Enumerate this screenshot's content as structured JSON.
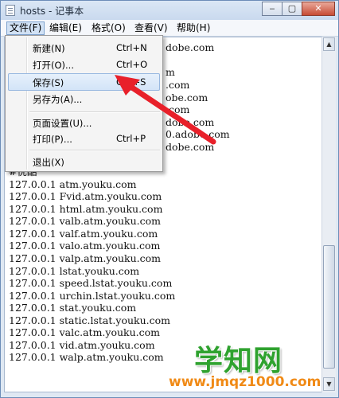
{
  "window": {
    "title": "hosts - 记事本"
  },
  "menubar": {
    "items": [
      {
        "label": "文件(F)"
      },
      {
        "label": "编辑(E)"
      },
      {
        "label": "格式(O)"
      },
      {
        "label": "查看(V)"
      },
      {
        "label": "帮助(H)"
      }
    ]
  },
  "file_menu": {
    "items": [
      {
        "label": "新建(N)",
        "shortcut": "Ctrl+N"
      },
      {
        "label": "打开(O)...",
        "shortcut": "Ctrl+O"
      },
      {
        "label": "保存(S)",
        "shortcut": "Ctrl+S"
      },
      {
        "label": "另存为(A)..."
      },
      {
        "label": "页面设置(U)..."
      },
      {
        "label": "打印(P)...",
        "shortcut": "Ctrl+P"
      },
      {
        "label": "退出(X)"
      }
    ]
  },
  "editor": {
    "hidden_fragments": [
      "dobe.com",
      "m",
      ".com",
      "obe.com",
      ".com",
      "dobe.com",
      "0.adobe.com",
      "dobe.com",
      "#优酷"
    ],
    "lines": [
      "127.0.0.1 atm.youku.com",
      "127.0.0.1 Fvid.atm.youku.com",
      "127.0.0.1 html.atm.youku.com",
      "127.0.0.1 valb.atm.youku.com",
      "127.0.0.1 valf.atm.youku.com",
      "127.0.0.1 valo.atm.youku.com",
      "127.0.0.1 valp.atm.youku.com",
      "127.0.0.1 lstat.youku.com",
      "127.0.0.1 speed.lstat.youku.com",
      "127.0.0.1 urchin.lstat.youku.com",
      "127.0.0.1 stat.youku.com",
      "127.0.0.1 static.lstat.youku.com",
      "127.0.0.1 valc.atm.youku.com",
      "127.0.0.1 vid.atm.youku.com",
      "127.0.0.1 walp.atm.youku.com"
    ]
  },
  "watermark": {
    "main": "学知网",
    "url": "www.jmqz1000.com"
  },
  "colors": {
    "arrow": "#e8202a",
    "watermark_main": "#2fa22f",
    "watermark_url": "#f08a16"
  }
}
